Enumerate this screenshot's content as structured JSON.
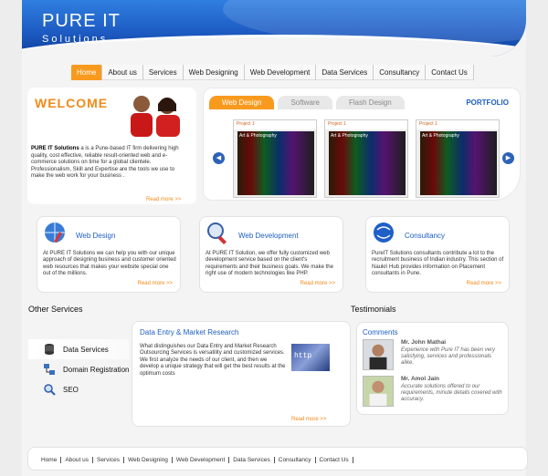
{
  "header": {
    "brand_title": "PURE IT",
    "brand_subtitle": "Solutions"
  },
  "nav": [
    "Home",
    "About us",
    "Services",
    "Web Designing",
    "Web Development",
    "Data Services",
    "Consultancy",
    "Contact Us"
  ],
  "welcome": {
    "title": "WELCOME",
    "company": "PURE IT Solutions",
    "text": " a is a Pune-based IT firm delivering high quality, cost effective, reliable result-oriented web and e-commerce solutions on time for a global clientele. Professionalism, Skill and Expertise are the tools we use to make the web work for your business .",
    "more": "Read more >>"
  },
  "portfolio": {
    "tabs": [
      "Web Design",
      "Software",
      "Flash Design"
    ],
    "title": "PORTFOLIO",
    "projects": [
      {
        "label": "Project 1",
        "caption": "Art & Photography"
      },
      {
        "label": "Project 1",
        "caption": "Art & Photography"
      },
      {
        "label": "Project 1",
        "caption": "Art & Photography"
      }
    ]
  },
  "cards": [
    {
      "title": "Web Design",
      "text": "At PURE IT Solutions we can help you with our unique approach of designing business and customer oriented web resources that makes your website special one out of the millions.",
      "more": "Read more >>"
    },
    {
      "title": "Web Development",
      "text": "At PURE IT Solution, we offer fully customized web development service based on the client's requirements and their business goals. We make the right use of modern technologies like PHP.",
      "more": "Read more >>"
    },
    {
      "title": "Consultancy",
      "text": "PureIT Solutions consultants contribute a lot to the recruitment business of Indian industry. This section of Naukri Hub provides information on Placement consultants in Pune.",
      "more": "Read more >>"
    }
  ],
  "other_services": {
    "title": "Other Services",
    "items": [
      "Data Services",
      "Domain Registration",
      "SEO"
    ],
    "panel_title": "Data Entry & Market Research",
    "panel_text": "What distinguishes our Data Entry and Market Research Outsourcing Services is versatility and customized services. We first analyze the needs of our client, and then we develop a unique strategy that will get the best results at the optimum costs",
    "panel_img_text": "http",
    "more": "Read more >>"
  },
  "testimonials": {
    "title": "Testimonials",
    "comments_label": "Comments",
    "items": [
      {
        "name": "Mr. John Mathai",
        "quote": "Experience with Pure IT has been very satisfying, services and professionals alike."
      },
      {
        "name": "Mr. Amol Jain",
        "quote": "Accurate solutions offered to our requirements, minute details covered with accuracy."
      }
    ]
  },
  "footer": [
    "Home",
    "About us",
    "Services",
    "Web Designing",
    "Web Development",
    "Data Services",
    "Consultancy",
    "Contact Us"
  ],
  "colors": {
    "accent": "#f89a1e",
    "link_blue": "#1d5fc0",
    "header_blue": "#1e5cc4"
  }
}
